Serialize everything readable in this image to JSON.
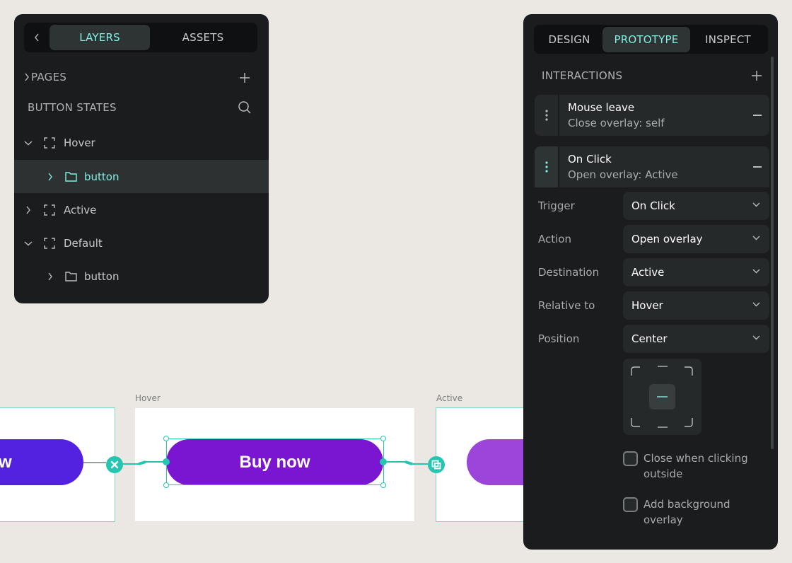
{
  "layers_panel": {
    "tabs": [
      "LAYERS",
      "ASSETS"
    ],
    "active_tab": "LAYERS",
    "pages_label": "PAGES",
    "section_title": "BUTTON STATES",
    "tree": [
      {
        "label": "Hover",
        "type": "frame",
        "expanded": true,
        "depth": 0
      },
      {
        "label": "button",
        "type": "folder",
        "expanded": false,
        "depth": 1,
        "selected": true
      },
      {
        "label": "Active",
        "type": "frame",
        "expanded": false,
        "depth": 0
      },
      {
        "label": "Default",
        "type": "frame",
        "expanded": true,
        "depth": 0
      },
      {
        "label": "button",
        "type": "folder",
        "expanded": false,
        "depth": 1
      }
    ]
  },
  "canvas": {
    "boards": [
      {
        "label": "Hover",
        "button_text": "Buy now",
        "button_color": "#7a15d2"
      },
      {
        "label": "Active",
        "button_color": "#9b45da"
      }
    ],
    "default_button_color": "#5321e0",
    "default_button_fragment": "w",
    "accent": "#24c6b0"
  },
  "inspector": {
    "tabs": [
      "DESIGN",
      "PROTOTYPE",
      "INSPECT"
    ],
    "active_tab": "PROTOTYPE",
    "interactions_title": "INTERACTIONS",
    "interactions": [
      {
        "title": "Mouse leave",
        "subtitle": "Close overlay: self"
      },
      {
        "title": "On Click",
        "subtitle": "Open overlay: Active"
      }
    ],
    "fields": [
      {
        "label": "Trigger",
        "value": "On Click"
      },
      {
        "label": "Action",
        "value": "Open overlay"
      },
      {
        "label": "Destination",
        "value": "Active"
      },
      {
        "label": "Relative to",
        "value": "Hover"
      },
      {
        "label": "Position",
        "value": "Center"
      }
    ],
    "checkboxes": [
      {
        "label": "Close when clicking outside",
        "checked": false
      },
      {
        "label": "Add background overlay",
        "checked": false
      }
    ]
  },
  "colors": {
    "panel_bg": "#1b1c1e",
    "active_accent": "#7ff0e3",
    "canvas_bg": "#ebe7e3"
  }
}
